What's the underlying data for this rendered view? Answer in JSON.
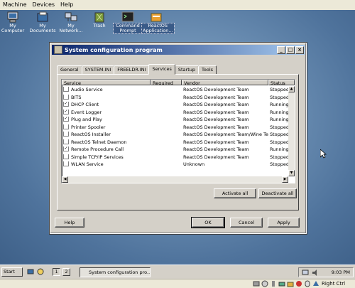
{
  "host_menu": [
    "Machine",
    "Devices",
    "Help"
  ],
  "desktop_icons": [
    {
      "name": "my-computer-icon",
      "label": "My Computer"
    },
    {
      "name": "my-documents-icon",
      "label": "My Documents"
    },
    {
      "name": "my-network-icon",
      "label": "My Network..."
    },
    {
      "name": "trash-icon",
      "label": "Trash"
    },
    {
      "name": "command-prompt-icon",
      "label": "Command Prompt"
    },
    {
      "name": "reactos-applications-icon",
      "label": "ReactOS Application..."
    }
  ],
  "window": {
    "title": "System configuration program",
    "tabs": [
      "General",
      "SYSTEM.INI",
      "FREELDR.INI",
      "Services",
      "Startup",
      "Tools"
    ],
    "active_tab": "Services",
    "columns": [
      "Service",
      "Required",
      "Vendor",
      "Status"
    ],
    "rows": [
      {
        "service": "Audio Service",
        "checked": false,
        "required": "",
        "vendor": "ReactOS Development Team",
        "status": "Stopped"
      },
      {
        "service": "BITS",
        "checked": false,
        "required": "",
        "vendor": "ReactOS Development Team",
        "status": "Stopped"
      },
      {
        "service": "DHCP Client",
        "checked": true,
        "required": "",
        "vendor": "ReactOS Development Team",
        "status": "Running"
      },
      {
        "service": "Event Logger",
        "checked": true,
        "required": "",
        "vendor": "ReactOS Development Team",
        "status": "Running"
      },
      {
        "service": "Plug and Play",
        "checked": true,
        "required": "",
        "vendor": "ReactOS Development Team",
        "status": "Running"
      },
      {
        "service": "Printer Spooler",
        "checked": false,
        "required": "",
        "vendor": "ReactOS Development Team",
        "status": "Stopped"
      },
      {
        "service": "ReactOS Installer",
        "checked": false,
        "required": "",
        "vendor": "ReactOS Development Team/Wine Team",
        "status": "Stopped"
      },
      {
        "service": "ReactOS Telnet Daemon",
        "checked": false,
        "required": "",
        "vendor": "ReactOS Development Team",
        "status": "Stopped"
      },
      {
        "service": "Remote Procedure Call",
        "checked": true,
        "required": "",
        "vendor": "ReactOS Development Team",
        "status": "Running"
      },
      {
        "service": "Simple TCP/IP Services",
        "checked": false,
        "required": "",
        "vendor": "ReactOS Development Team",
        "status": "Stopped"
      },
      {
        "service": "WLAN Service",
        "checked": false,
        "required": "",
        "vendor": "Unknown",
        "status": "Stopped"
      }
    ],
    "activate_all": "Activate all",
    "deactivate_all": "Deactivate all",
    "help": "Help",
    "ok": "OK",
    "cancel": "Cancel",
    "apply": "Apply"
  },
  "taskbar": {
    "start": "Start",
    "desktops": [
      "1",
      "2"
    ],
    "task": "System configuration pro...",
    "clock": "9:03 PM"
  },
  "host_status": {
    "host_key": "Right Ctrl"
  }
}
